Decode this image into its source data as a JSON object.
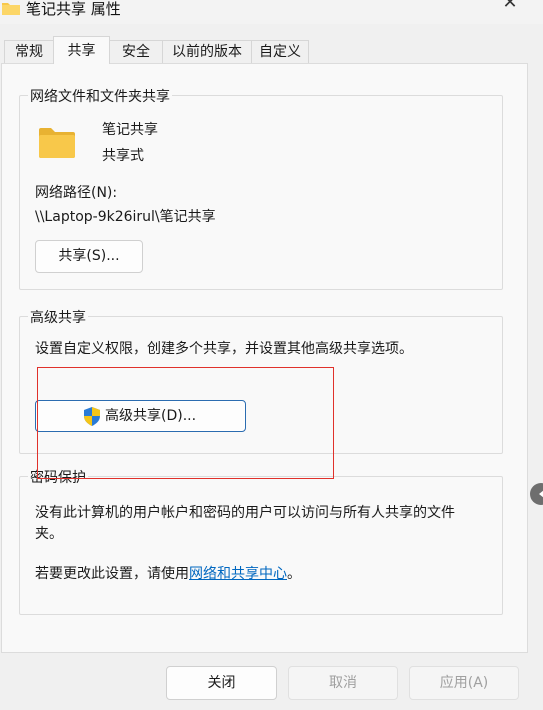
{
  "window": {
    "title": "笔记共享 属性",
    "close_glyph": "✕"
  },
  "tabs": [
    {
      "label": "常规"
    },
    {
      "label": "共享"
    },
    {
      "label": "安全"
    },
    {
      "label": "以前的版本"
    },
    {
      "label": "自定义"
    }
  ],
  "network_sharing": {
    "legend": "网络文件和文件夹共享",
    "folder_name": "笔记共享",
    "folder_status": "共享式",
    "path_label": "网络路径(N):",
    "path_value": "\\\\Laptop-9k26irul\\笔记共享",
    "share_button": "共享(S)..."
  },
  "advanced_sharing": {
    "legend": "高级共享",
    "description": "设置自定义权限，创建多个共享，并设置其他高级共享选项。",
    "button": "高级共享(D)..."
  },
  "password_protection": {
    "legend": "密码保护",
    "description_line1": "没有此计算机的用户帐户和密码的用户可以访问与所有人共享的文件",
    "description_line2": "夹。",
    "change_text": "若要更改此设置，请使用",
    "link_text": "网络和共享中心",
    "period": "。"
  },
  "footer": {
    "close_button": "关闭",
    "cancel_button": "取消",
    "apply_button": "应用(A)"
  },
  "colors": {
    "accent": "#0067c0",
    "highlight_box": "#e0312b",
    "folder_yellow": "#f8c84a"
  }
}
